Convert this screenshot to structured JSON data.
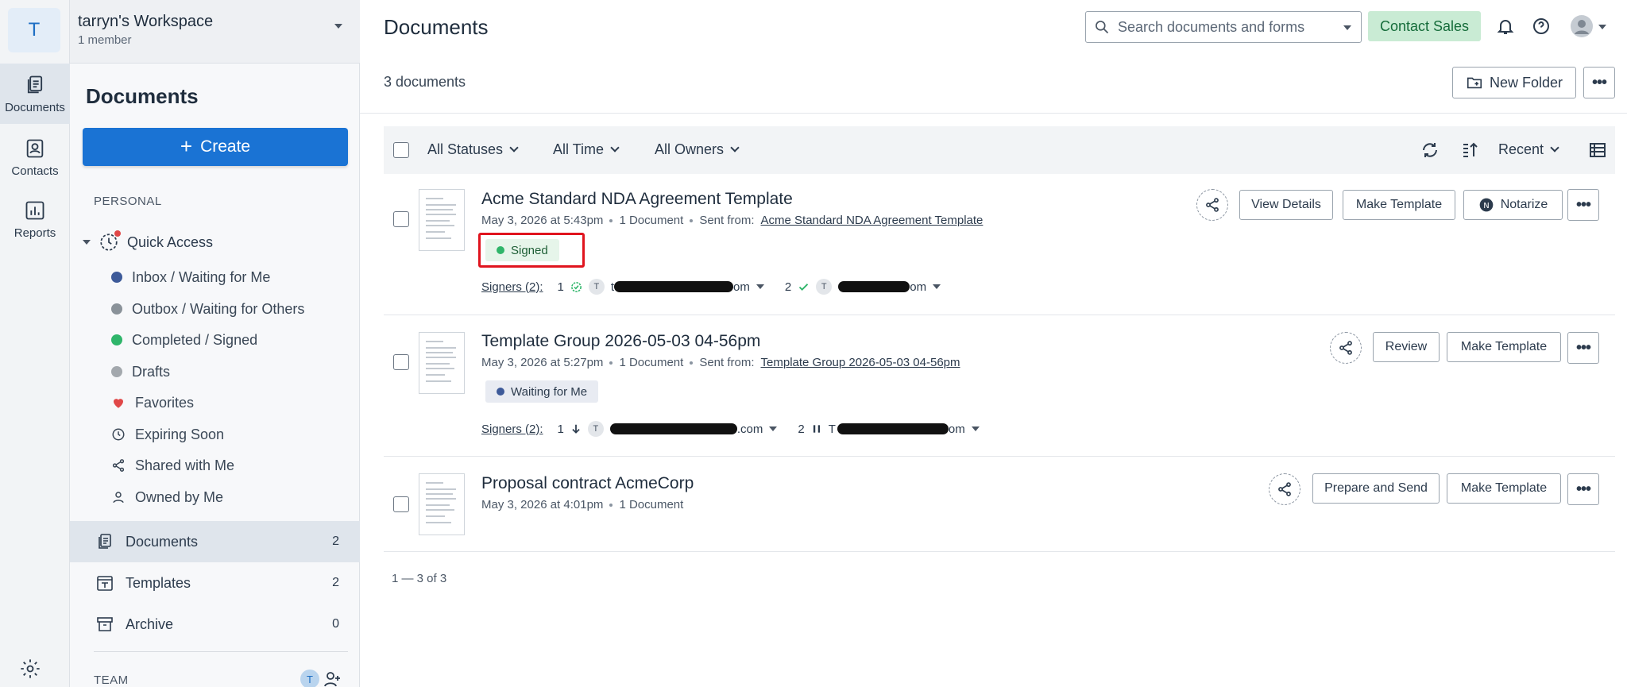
{
  "workspace": {
    "initial": "T",
    "name": "tarryn's Workspace",
    "members": "1 member"
  },
  "rail": {
    "documents": "Documents",
    "contacts": "Contacts",
    "reports": "Reports"
  },
  "sidebar": {
    "title": "Documents",
    "create_label": "Create",
    "personal_label": "PERSONAL",
    "quick_access": "Quick Access",
    "items": [
      {
        "label": "Inbox / Waiting for Me",
        "color": "#3d5a99"
      },
      {
        "label": "Outbox / Waiting for Others",
        "color": "#8a9299"
      },
      {
        "label": "Completed / Signed",
        "color": "#2fb56a"
      },
      {
        "label": "Drafts",
        "color": "#a3a8ad"
      },
      {
        "label": "Favorites",
        "color": "#e04848"
      },
      {
        "label": "Expiring Soon"
      },
      {
        "label": "Shared with Me"
      },
      {
        "label": "Owned by Me"
      }
    ],
    "main_items": [
      {
        "label": "Documents",
        "count": "2"
      },
      {
        "label": "Templates",
        "count": "2"
      },
      {
        "label": "Archive",
        "count": "0"
      }
    ],
    "team_label": "TEAM",
    "team_avatar": "T"
  },
  "header": {
    "title": "Documents",
    "search_placeholder": "Search documents and forms",
    "contact_sales": "Contact Sales",
    "doc_count": "3 documents",
    "new_folder": "New Folder",
    "more": "•••"
  },
  "filters": {
    "statuses": "All Statuses",
    "time": "All Time",
    "owners": "All Owners",
    "sort": "Recent"
  },
  "documents": [
    {
      "title": "Acme Standard NDA Agreement Template",
      "date": "May 3, 2026 at 5:43pm",
      "docs": "1 Document",
      "sent_from_label": "Sent from:",
      "sent_from": "Acme Standard NDA Agreement Template",
      "status": "Signed",
      "status_color": "#2fb56a",
      "signers_label": "Signers (2):",
      "signer1_num": "1",
      "signer1_prefix": "t",
      "signer1_suffix": "om",
      "signer2_num": "2",
      "signer2_prefix": "T",
      "signer2_suffix": "om",
      "actions": [
        "View Details",
        "Make Template",
        "Notarize"
      ]
    },
    {
      "title": "Template Group 2026-05-03 04-56pm",
      "date": "May 3, 2026 at 5:27pm",
      "docs": "1 Document",
      "sent_from_label": "Sent from:",
      "sent_from": "Template Group 2026-05-03 04-56pm",
      "status": "Waiting for Me",
      "status_color": "#3d5a99",
      "signers_label": "Signers (2):",
      "signer1_num": "1",
      "signer1_suffix": ".com",
      "signer2_num": "2",
      "signer2_prefix": "T",
      "signer2_suffix": "om",
      "actions": [
        "Review",
        "Make Template"
      ]
    },
    {
      "title": "Proposal contract AcmeCorp",
      "date": "May 3, 2026 at 4:01pm",
      "docs": "1 Document",
      "actions": [
        "Prepare and Send",
        "Make Template"
      ]
    }
  ],
  "pagination": "1 — 3 of 3",
  "more_label": "•••"
}
